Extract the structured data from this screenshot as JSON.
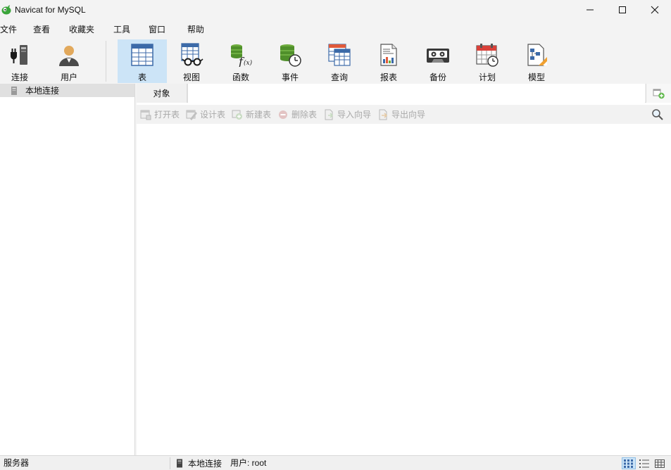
{
  "window": {
    "title": "Navicat for MySQL",
    "controls": [
      "minimize",
      "maximize",
      "close"
    ]
  },
  "menu": [
    "文件",
    "查看",
    "收藏夹",
    "工具",
    "窗口",
    "帮助"
  ],
  "toolbar": {
    "connection": "连接",
    "user": "用户",
    "table": "表",
    "view": "视图",
    "function": "函数",
    "event": "事件",
    "query": "查询",
    "report": "报表",
    "backup": "备份",
    "schedule": "计划",
    "model": "模型",
    "active": "表"
  },
  "navigation": {
    "connection_name": "本地连接"
  },
  "tabs": {
    "objects": "对象"
  },
  "object_toolbar": {
    "open_table": "打开表",
    "design_table": "设计表",
    "new_table": "新建表",
    "delete_table": "删除表",
    "import_wizard": "导入向导",
    "export_wizard": "导出向导"
  },
  "status": {
    "server": "服务器",
    "connection": "本地连接",
    "user": "用户: root"
  },
  "colors": {
    "accent_selected": "#cce4f7",
    "logo_green": "#3aa43a",
    "disabled_text": "#a8a8a8"
  }
}
